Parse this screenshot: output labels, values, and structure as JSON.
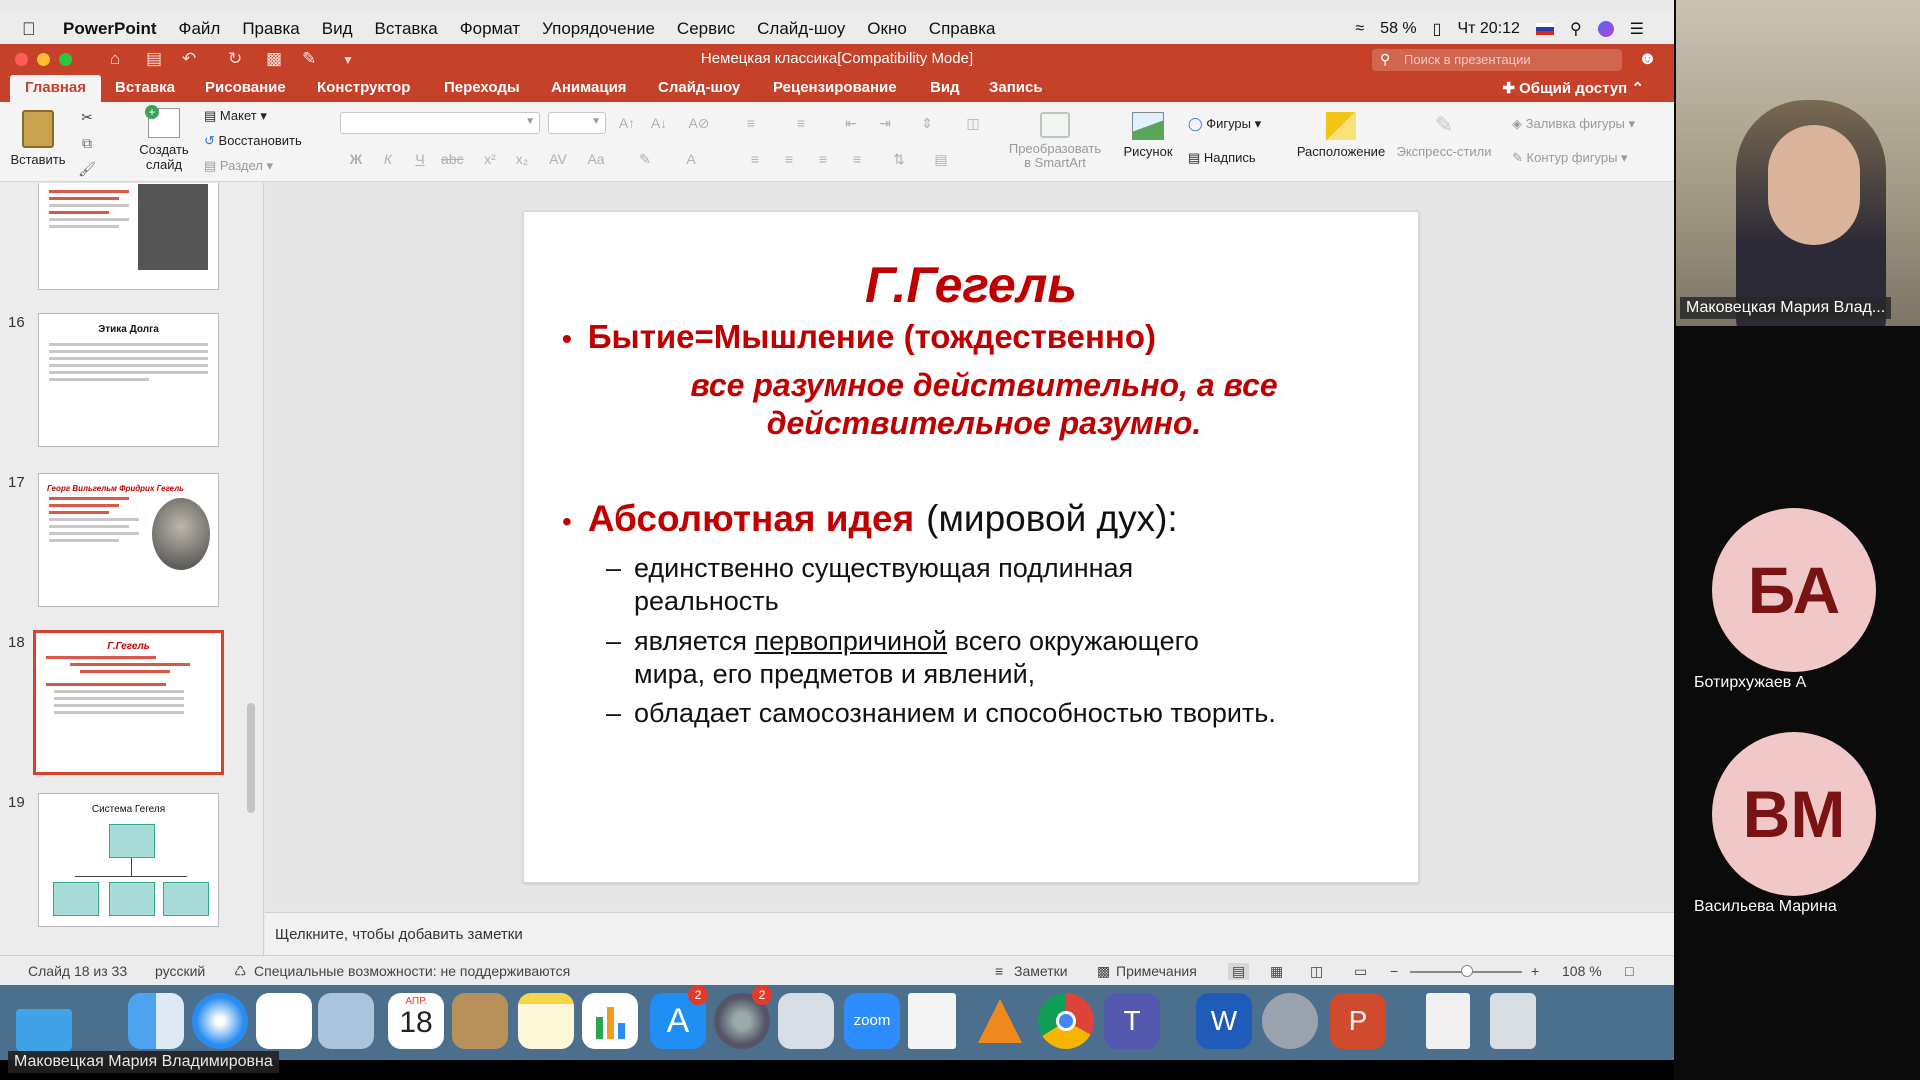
{
  "menubar": {
    "app_name": "PowerPoint",
    "items": [
      "Файл",
      "Правка",
      "Вид",
      "Вставка",
      "Формат",
      "Упорядочение",
      "Сервис",
      "Слайд-шоу",
      "Окно",
      "Справка"
    ],
    "battery": "58 %",
    "clock": "Чт 20:12"
  },
  "window": {
    "title": "Немецкая классика[Compatibility Mode]",
    "search_placeholder": "Поиск в презентации"
  },
  "ribbon_tabs": {
    "items": [
      "Главная",
      "Вставка",
      "Рисование",
      "Конструктор",
      "Переходы",
      "Анимация",
      "Слайд-шоу",
      "Рецензирование",
      "Вид",
      "Запись"
    ],
    "active": "Главная",
    "share": "Общий доступ"
  },
  "ribbon": {
    "paste": "Вставить",
    "new_slide_1": "Создать",
    "new_slide_2": "слайд",
    "layout": "Макет",
    "reset": "Восстановить",
    "section": "Раздел",
    "smartart_1": "Преобразовать",
    "smartart_2": "в SmartArt",
    "picture": "Рисунок",
    "shapes": "Фигуры",
    "textbox": "Надпись",
    "arrange": "Расположение",
    "quick_styles": "Экспресс-стили",
    "shape_fill": "Заливка фигуры",
    "shape_outline": "Контур фигуры"
  },
  "thumbnails": [
    {
      "number": "16",
      "title": "Этика Долга"
    },
    {
      "number": "17",
      "title": "Георг Вильгельм Фридрих Гегель"
    },
    {
      "number": "18",
      "title": "Г.Гегель"
    },
    {
      "number": "19",
      "title": "Система Гегеля"
    }
  ],
  "slide": {
    "heading": "Г.Гегель",
    "bullet1": "Бытие=Мышление (тождественно)",
    "quote_line1": "все разумное действительно, а все",
    "quote_line2": "действительное разумно.",
    "bullet2_strong": "Абсолютная идея",
    "bullet2_rest": "(мировой дух):",
    "sub1_line1": "единственно существующая подлинная",
    "sub1_line2": "реальность",
    "sub2_prefix": "является",
    "sub2_underlined": "первопричиной",
    "sub2_suffix": "всего окружающего",
    "sub2_line2": "мира, его предметов и явлений,",
    "sub3": "обладает самосознанием и способностью творить."
  },
  "notes_placeholder": "Щелкните, чтобы добавить заметки",
  "statusbar": {
    "slide_counter": "Слайд 18 из 33",
    "language": "русский",
    "accessibility": "Специальные возможности: не поддерживаются",
    "notes": "Заметки",
    "comments": "Примечания",
    "zoom": "108 %"
  },
  "dock": {
    "calendar_month": "АПР.",
    "calendar_day": "18",
    "appstore_badge": "2",
    "settings_badge": "2",
    "zoom_label": "zoom"
  },
  "presenter_name": "Маковецкая Мария Владимировна",
  "participants": [
    {
      "name": "Маковецкая Мария Влад...",
      "initials": ""
    },
    {
      "name": "Ботирхужаев А",
      "initials": "БА"
    },
    {
      "name": "Васильева Марина",
      "initials": "ВМ"
    }
  ],
  "colors": {
    "accent": "#c6412a",
    "slide_red": "#c00000",
    "avatar_bg": "#f0c8c8"
  }
}
